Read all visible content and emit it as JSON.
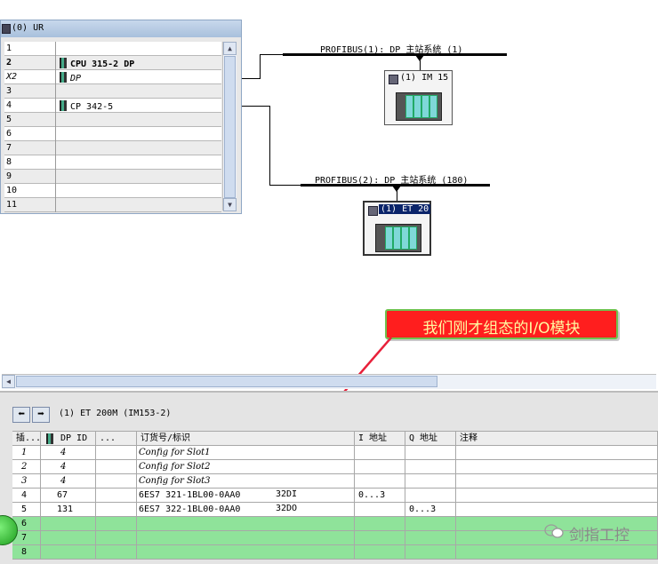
{
  "rack": {
    "title": "(0) UR",
    "rows": [
      {
        "slot": "1",
        "module": ""
      },
      {
        "slot": "2",
        "module": "CPU 315-2 DP"
      },
      {
        "slot": "X2",
        "module": "DP"
      },
      {
        "slot": "3",
        "module": ""
      },
      {
        "slot": "4",
        "module": "CP 342-5"
      },
      {
        "slot": "5",
        "module": ""
      },
      {
        "slot": "6",
        "module": ""
      },
      {
        "slot": "7",
        "module": ""
      },
      {
        "slot": "8",
        "module": ""
      },
      {
        "slot": "9",
        "module": ""
      },
      {
        "slot": "10",
        "module": ""
      },
      {
        "slot": "11",
        "module": ""
      }
    ]
  },
  "network": {
    "bus1": "PROFIBUS(1): DP 主站系统 (1)",
    "bus2": "PROFIBUS(2): DP 主站系统 (180)",
    "station1": "(1) IM 15",
    "station2": "(1) ET 20"
  },
  "callout": "我们刚才组态的I/O模块",
  "lower": {
    "title": "(1)   ET 200M (IM153-2)",
    "headers": [
      "插...",
      "DP ID",
      "...",
      "订货号/标识",
      "I 地址",
      "Q 地址",
      "注释"
    ],
    "rows": [
      {
        "slot": "1",
        "dpid": "4",
        "order": "Config for Slot1",
        "type": "",
        "i_addr": "",
        "q_addr": "",
        "italic": true,
        "green": false
      },
      {
        "slot": "2",
        "dpid": "4",
        "order": "Config for Slot2",
        "type": "",
        "i_addr": "",
        "q_addr": "",
        "italic": true,
        "green": false
      },
      {
        "slot": "3",
        "dpid": "4",
        "order": "Config for Slot3",
        "type": "",
        "i_addr": "",
        "q_addr": "",
        "italic": true,
        "green": false
      },
      {
        "slot": "4",
        "dpid": "67",
        "order": "6ES7 321-1BL00-0AA0",
        "type": "32DI",
        "i_addr": "0...3",
        "q_addr": "",
        "italic": false,
        "green": false
      },
      {
        "slot": "5",
        "dpid": "131",
        "order": "6ES7 322-1BL00-0AA0",
        "type": "32DO",
        "i_addr": "",
        "q_addr": "0...3",
        "italic": false,
        "green": false
      },
      {
        "slot": "6",
        "dpid": "",
        "order": "",
        "type": "",
        "i_addr": "",
        "q_addr": "",
        "italic": false,
        "green": true
      },
      {
        "slot": "7",
        "dpid": "",
        "order": "",
        "type": "",
        "i_addr": "",
        "q_addr": "",
        "italic": false,
        "green": true
      },
      {
        "slot": "8",
        "dpid": "",
        "order": "",
        "type": "",
        "i_addr": "",
        "q_addr": "",
        "italic": false,
        "green": true
      }
    ]
  },
  "watermark": "剑指工控",
  "colors": {
    "callout_bg": "#ff1e1e",
    "callout_text": "#fff8a0",
    "empty_slot_green": "#8fe39a",
    "arrow": "#e8203a"
  }
}
